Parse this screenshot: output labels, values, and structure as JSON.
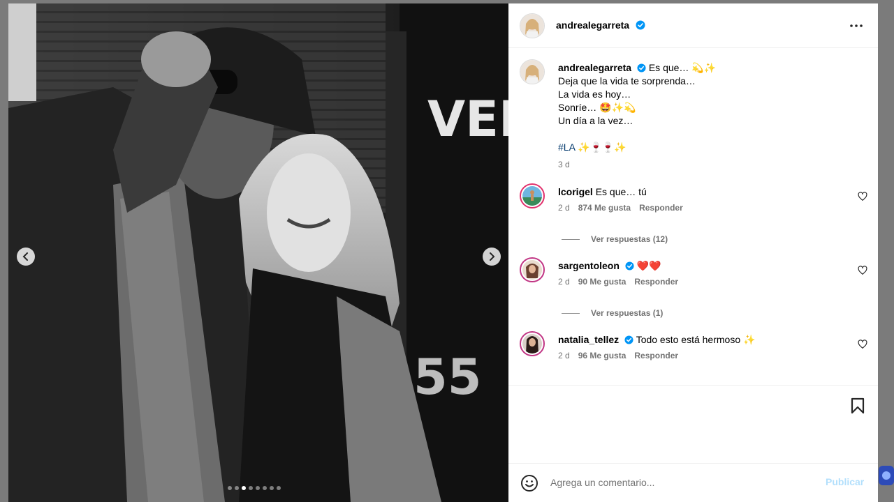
{
  "post": {
    "author": "andrealegarreta",
    "carousel": {
      "total": 8,
      "active_index": 2
    }
  },
  "caption": {
    "username": "andrealegarreta",
    "lines": [
      "Es que… 💫✨",
      "Deja que la vida te sorprenda…",
      "La vida es hoy…",
      "Sonríe… 🤩✨💫",
      "Un día a la vez…"
    ],
    "hashtag": "#LA",
    "hashtag_emoji": "✨🍷🍷✨",
    "time": "3 d"
  },
  "comments": [
    {
      "username": "lcorigel",
      "verified": false,
      "text": "Es que… tú",
      "time": "2 d",
      "likes": "874 Me gusta",
      "reply": "Responder",
      "view_replies": "Ver respuestas (12)"
    },
    {
      "username": "sargentoleon",
      "verified": true,
      "text": "❤️❤️",
      "time": "2 d",
      "likes": "90 Me gusta",
      "reply": "Responder",
      "view_replies": "Ver respuestas (1)"
    },
    {
      "username": "natalia_tellez",
      "verified": true,
      "text": "Todo esto está hermoso ✨",
      "time": "2 d",
      "likes": "96 Me gusta",
      "reply": "Responder",
      "view_replies": ""
    }
  ],
  "comment_bar": {
    "placeholder": "Agrega un comentario...",
    "publish_label": "Publicar"
  },
  "icons": {
    "verified": "verified-badge-icon",
    "more": "more-options-icon",
    "heart": "heart-icon",
    "bookmark": "bookmark-icon",
    "emoji": "emoji-icon",
    "prev": "chevron-left-icon",
    "next": "chevron-right-icon"
  },
  "colors": {
    "verified_blue": "#0095f6",
    "link_blue": "#00376b",
    "publish_disabled": "#b2dffc",
    "meta_gray": "#737373"
  }
}
